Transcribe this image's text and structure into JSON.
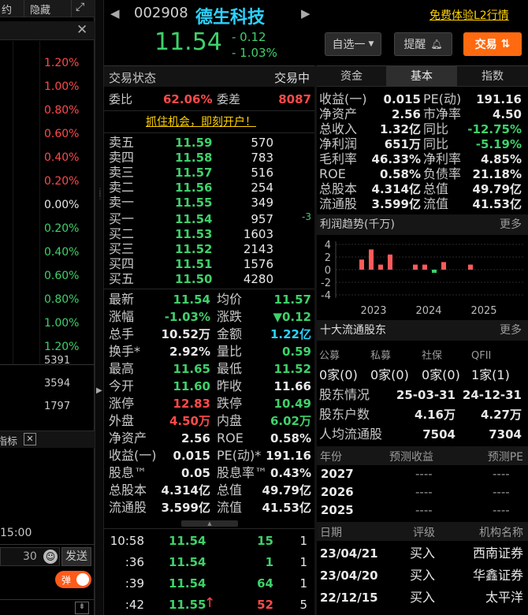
{
  "left": {
    "top_text": "约",
    "hide_label": "隐藏",
    "pct_labels": [
      {
        "t": "1.20%",
        "c": "red"
      },
      {
        "t": "1.00%",
        "c": "red"
      },
      {
        "t": "0.80%",
        "c": "red"
      },
      {
        "t": "0.60%",
        "c": "red"
      },
      {
        "t": "0.40%",
        "c": "red"
      },
      {
        "t": "0.20%",
        "c": "red"
      },
      {
        "t": "0.00%",
        "c": "white"
      },
      {
        "t": "0.20%",
        "c": "green"
      },
      {
        "t": "0.40%",
        "c": "green"
      },
      {
        "t": "0.60%",
        "c": "green"
      },
      {
        "t": "0.80%",
        "c": "green"
      },
      {
        "t": "1.00%",
        "c": "green"
      },
      {
        "t": "1.20%",
        "c": "green"
      }
    ],
    "vol_labels": [
      "5391",
      "3594",
      "1797"
    ],
    "indicator_label": "指标",
    "time_label": "15:00",
    "input_value": "30",
    "send_label": "发送",
    "toggle_label": "弹"
  },
  "header": {
    "code": "002908",
    "name": "德生科技",
    "trial_link": "免费体验L2行情",
    "price": "11.54",
    "change": "- 0.12",
    "change_pct": "- 1.03%",
    "watch_label": "自选一",
    "alert_label": "提醒",
    "trade_label": "交易"
  },
  "status": {
    "label": "交易状态",
    "value": "交易中"
  },
  "wb": {
    "label1": "委比",
    "val1": "62.06%",
    "label2": "委差",
    "val2": "8087"
  },
  "promo": "抓住机会，即刻开户！",
  "sells": [
    {
      "label": "卖五",
      "price": "11.59",
      "vol": "570",
      "delta": ""
    },
    {
      "label": "卖四",
      "price": "11.58",
      "vol": "783",
      "delta": ""
    },
    {
      "label": "卖三",
      "price": "11.57",
      "vol": "516",
      "delta": ""
    },
    {
      "label": "卖二",
      "price": "11.56",
      "vol": "254",
      "delta": ""
    },
    {
      "label": "卖一",
      "price": "11.55",
      "vol": "349",
      "delta": ""
    }
  ],
  "buys": [
    {
      "label": "买一",
      "price": "11.54",
      "vol": "957",
      "delta": "-3"
    },
    {
      "label": "买二",
      "price": "11.53",
      "vol": "1603",
      "delta": ""
    },
    {
      "label": "买三",
      "price": "11.52",
      "vol": "2143",
      "delta": ""
    },
    {
      "label": "买四",
      "price": "11.51",
      "vol": "1576",
      "delta": ""
    },
    {
      "label": "买五",
      "price": "11.50",
      "vol": "4280",
      "delta": ""
    }
  ],
  "stats": [
    {
      "l1": "最新",
      "v1": "11.54",
      "c1": "green",
      "l2": "均价",
      "v2": "11.57",
      "c2": "green"
    },
    {
      "l1": "涨幅",
      "v1": "-1.03%",
      "c1": "green",
      "l2": "涨跌",
      "v2": "▼0.12",
      "c2": "green"
    },
    {
      "l1": "总手",
      "v1": "10.52万",
      "c1": "white",
      "l2": "金额",
      "v2": "1.22亿",
      "c2": "cyan"
    },
    {
      "l1": "换手*",
      "v1": "2.92%",
      "c1": "white",
      "l2": "量比",
      "v2": "0.59",
      "c2": "green"
    },
    {
      "l1": "最高",
      "v1": "11.65",
      "c1": "green",
      "l2": "最低",
      "v2": "11.52",
      "c2": "green"
    },
    {
      "l1": "今开",
      "v1": "11.60",
      "c1": "green",
      "l2": "昨收",
      "v2": "11.66",
      "c2": "white"
    },
    {
      "l1": "涨停",
      "v1": "12.83",
      "c1": "red",
      "l2": "跌停",
      "v2": "10.49",
      "c2": "green"
    },
    {
      "l1": "外盘",
      "v1": "4.50万",
      "c1": "red",
      "l2": "内盘",
      "v2": "6.02万",
      "c2": "green"
    },
    {
      "l1": "净资产",
      "v1": "2.56",
      "c1": "white",
      "l2": "ROE",
      "v2": "0.58%",
      "c2": "white"
    },
    {
      "l1": "收益(一)",
      "v1": "0.015",
      "c1": "white",
      "l2": "PE(动)*",
      "v2": "191.16",
      "c2": "white"
    },
    {
      "l1": "股息™",
      "v1": "0.05",
      "c1": "white",
      "l2": "股息率™",
      "v2": "0.43%",
      "c2": "white"
    },
    {
      "l1": "总股本",
      "v1": "4.314亿",
      "c1": "white",
      "l2": "总值",
      "v2": "49.79亿",
      "c2": "white"
    },
    {
      "l1": "流通股",
      "v1": "3.599亿",
      "c1": "white",
      "l2": "流值",
      "v2": "41.53亿",
      "c2": "white"
    }
  ],
  "ticks": [
    {
      "time": "10:58",
      "price": "11.54",
      "vol": "15",
      "n": "1",
      "arrow": "",
      "pc": "green",
      "vc": "green"
    },
    {
      "time": ":36",
      "price": "11.54",
      "vol": "1",
      "n": "1",
      "arrow": "",
      "pc": "green",
      "vc": "green"
    },
    {
      "time": ":39",
      "price": "11.54",
      "vol": "64",
      "n": "1",
      "arrow": "",
      "pc": "green",
      "vc": "green"
    },
    {
      "time": ":42",
      "price": "11.55",
      "vol": "52",
      "n": "5",
      "arrow": "↑",
      "pc": "green",
      "vc": "red"
    }
  ],
  "tabs": [
    "资金",
    "基本",
    "指数"
  ],
  "fundamentals": [
    {
      "l1": "收益(一)",
      "v1": "0.015",
      "l2": "PE(动)",
      "v2": "191.16",
      "c2": "white"
    },
    {
      "l1": "净资产",
      "v1": "2.56",
      "l2": "市净率",
      "v2": "4.50",
      "c2": "white"
    },
    {
      "l1": "总收入",
      "v1": "1.32亿",
      "l2": "同比",
      "v2": "-12.75%",
      "c2": "green"
    },
    {
      "l1": "净利润",
      "v1": "651万",
      "l2": "同比",
      "v2": "-5.19%",
      "c2": "green"
    },
    {
      "l1": "毛利率",
      "v1": "46.33%",
      "l2": "净利率",
      "v2": "4.85%",
      "c2": "white"
    },
    {
      "l1": "ROE",
      "v1": "0.58%",
      "l2": "负债率",
      "v2": "21.18%",
      "c2": "white"
    },
    {
      "l1": "总股本",
      "v1": "4.314亿",
      "l2": "总值",
      "v2": "49.79亿",
      "c2": "white"
    },
    {
      "l1": "流通股",
      "v1": "3.599亿",
      "l2": "流值",
      "v2": "41.53亿",
      "c2": "white"
    }
  ],
  "profit": {
    "title": "利润趋势(千万)",
    "more": "更多"
  },
  "chart_data": {
    "type": "bar",
    "y_ticks": [
      "4",
      "2",
      "0",
      "-2",
      "-4"
    ],
    "ylim": [
      -4,
      4
    ],
    "x_ticks": [
      "2023",
      "2024",
      "2025"
    ],
    "values": [
      1.6,
      3.2,
      0.8,
      2.4,
      0.8,
      0.8,
      -0.5,
      1.2,
      0.8
    ]
  },
  "holders": {
    "title": "十大流通股东",
    "more": "更多",
    "cats": [
      "公募",
      "私募",
      "社保",
      "QFII"
    ],
    "counts": [
      "0家(0)",
      "0家(0)",
      "0家(0)",
      "1家(1)"
    ],
    "rows": [
      {
        "label": "股东情况",
        "v1": "25-03-31",
        "v2": "24-12-31"
      },
      {
        "label": "股东户数",
        "v1": "4.16万",
        "v2": "4.27万"
      },
      {
        "label": "人均流通股",
        "v1": "7504",
        "v2": "7304"
      }
    ]
  },
  "forecast": {
    "h1": "年份",
    "h2": "预测收益",
    "h3": "预测PE",
    "rows": [
      {
        "y": "2027",
        "a": "----",
        "b": "----"
      },
      {
        "y": "2026",
        "a": "----",
        "b": "----"
      },
      {
        "y": "2025",
        "a": "----",
        "b": "----"
      }
    ]
  },
  "ratings": {
    "h1": "日期",
    "h2": "评级",
    "h3": "机构名称",
    "rows": [
      {
        "d": "23/04/21",
        "r": "买入",
        "o": "西南证券"
      },
      {
        "d": "23/04/20",
        "r": "买入",
        "o": "华鑫证券"
      },
      {
        "d": "22/12/15",
        "r": "买入",
        "o": "太平洋"
      }
    ]
  }
}
